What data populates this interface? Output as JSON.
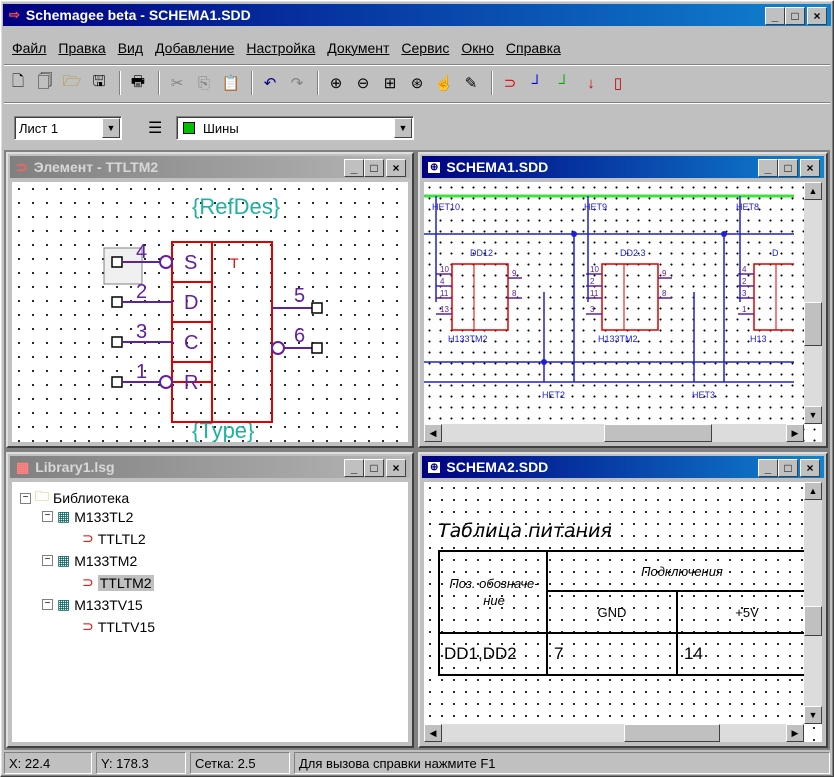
{
  "app": {
    "title": "Schemagee beta - SCHEMA1.SDD"
  },
  "menu": [
    "Файл",
    "Правка",
    "Вид",
    "Добавление",
    "Настройка",
    "Документ",
    "Сервис",
    "Окно",
    "Справка"
  ],
  "toolbar": {
    "icons": [
      "new-icon",
      "new-doc-icon",
      "open-icon",
      "save-icon",
      "print-icon",
      "cut-icon",
      "copy-icon",
      "paste-icon",
      "undo-icon",
      "redo-icon",
      "zoom-in-icon",
      "zoom-out-icon",
      "zoom-fit-icon",
      "zoom-area-icon",
      "pan-icon",
      "pen-icon",
      "gate-icon",
      "wire-icon",
      "bus-icon",
      "pin-icon",
      "chip-icon"
    ]
  },
  "sheet_select": {
    "value": "Лист 1"
  },
  "layer_select": {
    "value": "Шины",
    "color": "#00c000"
  },
  "windows": {
    "element": {
      "title": "Элемент - TTLTM2",
      "refdes": "{RefDes}",
      "type": "{Type}",
      "gate_label": "T",
      "pins_left": [
        "4",
        "2",
        "3",
        "1"
      ],
      "pin_labels": [
        "S",
        "D",
        "C",
        "R"
      ],
      "pins_right": [
        "5",
        "6"
      ]
    },
    "schema1": {
      "title": "SCHEMA1.SDD",
      "nets_top": [
        "НЕТ10",
        "НЕТ9",
        "НЕТ8"
      ],
      "nets_bottom": [
        "НЕТ2",
        "НЕТ3"
      ],
      "chips": [
        {
          "ref": "DD12",
          "type": "Н133ТМ2",
          "pins": [
            "10",
            "4",
            "11",
            "13"
          ],
          "out": [
            "9",
            "8"
          ]
        },
        {
          "ref": "DD2.3",
          "type": "Н133ТМ2",
          "pins": [
            "10",
            "2",
            "11",
            "3"
          ],
          "out": [
            "9",
            "8"
          ]
        },
        {
          "ref": "D",
          "type": "Н13",
          "pins": [
            "4",
            "2",
            "3",
            "1"
          ],
          "out": []
        }
      ]
    },
    "library": {
      "title": "Library1.lsg",
      "tree": [
        {
          "label": "Библиотека",
          "level": 0,
          "expander": "−",
          "icon": "folder-icon"
        },
        {
          "label": "M133TL2",
          "level": 1,
          "expander": "−",
          "icon": "library-module-icon"
        },
        {
          "label": "TTLTL2",
          "level": 2,
          "expander": "",
          "icon": "gate-symbol-icon"
        },
        {
          "label": "M133TM2",
          "level": 1,
          "expander": "−",
          "icon": "library-module-icon"
        },
        {
          "label": "TTLTM2",
          "level": 2,
          "expander": "",
          "icon": "gate-symbol-icon",
          "selected": true
        },
        {
          "label": "M133TV15",
          "level": 1,
          "expander": "−",
          "icon": "library-module-icon"
        },
        {
          "label": "TTLTV15",
          "level": 2,
          "expander": "",
          "icon": "gate-symbol-icon"
        }
      ]
    },
    "schema2": {
      "title": "SCHEMA2.SDD",
      "table_title": "Таблица питания",
      "col_pos": "Поз. обозначе- ние",
      "col_conn": "Подключения",
      "col_gnd": "GND",
      "col_5v": "+5V",
      "row_pos": "DD1,DD2",
      "row_gnd": "7",
      "row_5v": "14"
    }
  },
  "status": {
    "x": "X: 22.4",
    "y": "Y: 178.3",
    "grid": "Сетка: 2.5",
    "hint": "Для вызова справки нажмите F1"
  }
}
